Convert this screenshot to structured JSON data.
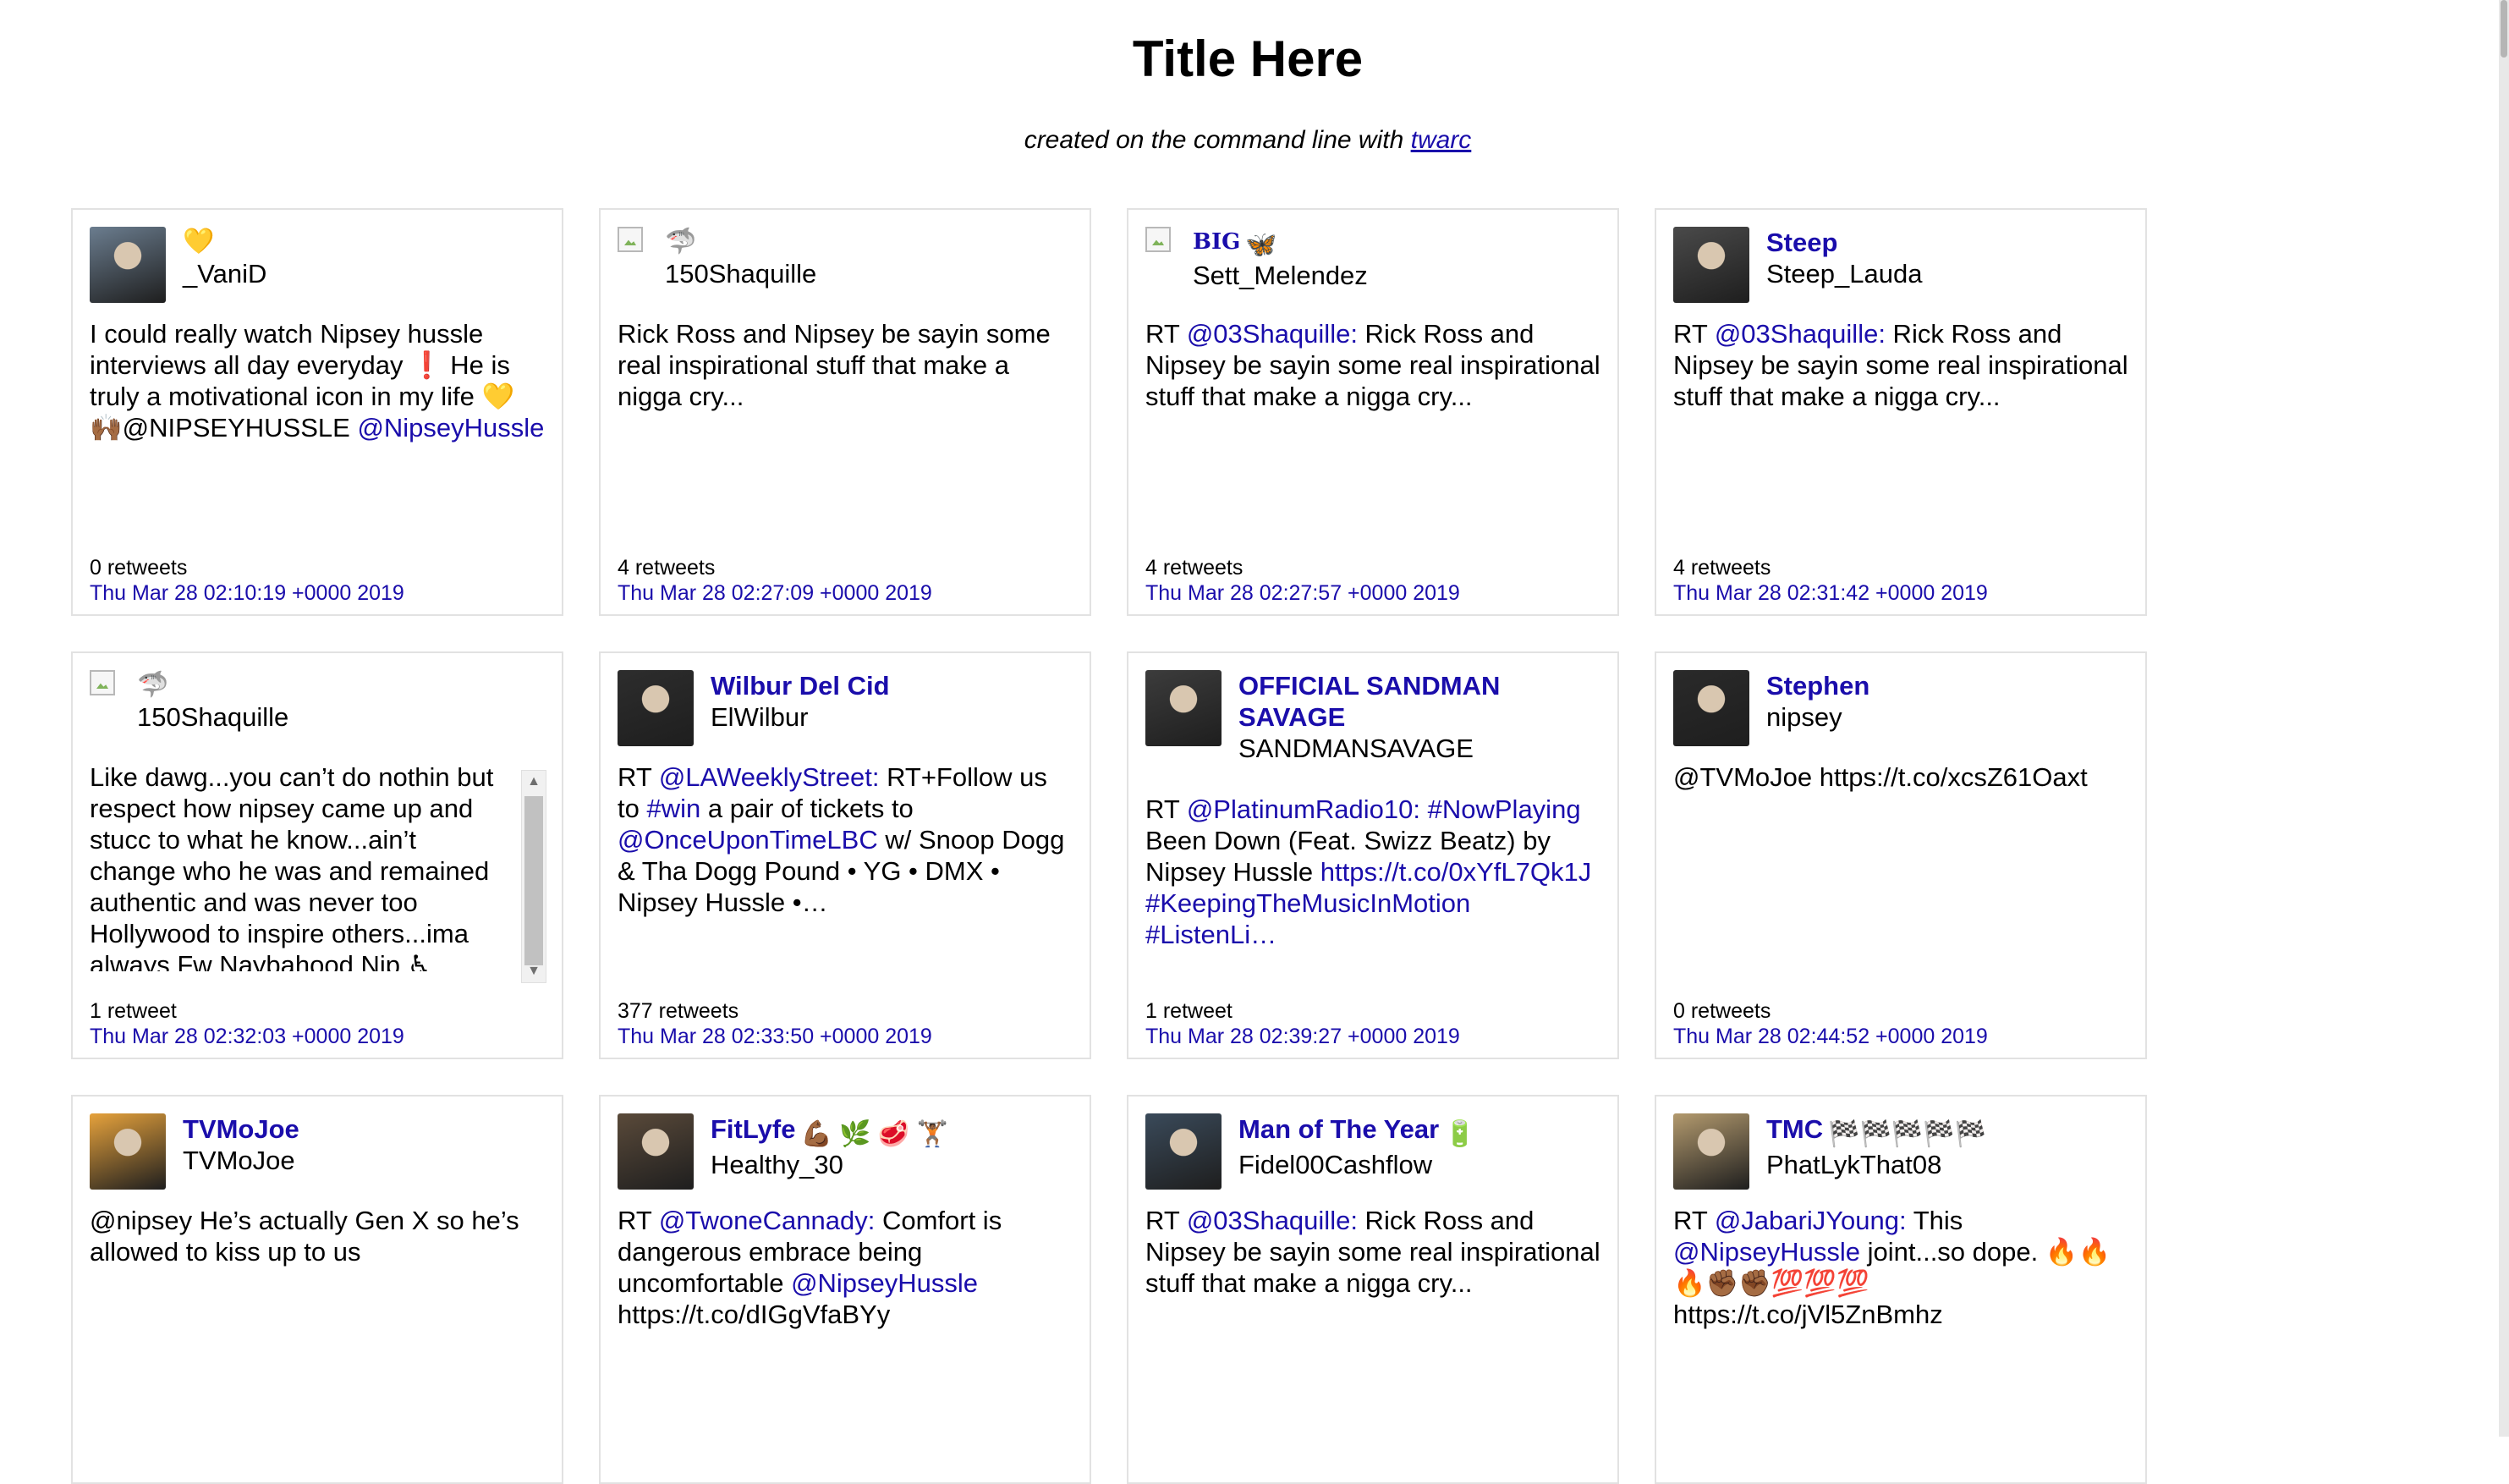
{
  "page": {
    "title": "Title Here",
    "subtitle_prefix": "created on the command line with ",
    "subtitle_link": "twarc"
  },
  "colors": {
    "link": "#1a0dab",
    "border": "#e2e2e2"
  },
  "cards": [
    {
      "display_name": "",
      "badge": "💛",
      "screen_name": "_VaniD",
      "avatar": "photo",
      "text_parts": [
        {
          "t": "I could really watch Nipsey hussle interviews all day everyday ❗ He is truly a motivational icon in my life 💛 🙌🏾@NIPSEYHUSSLE "
        },
        {
          "t": "@NipseyHussle",
          "link": true
        }
      ],
      "retweets": "0 retweets",
      "date": "Thu Mar 28 02:10:19 +0000 2019"
    },
    {
      "display_name": "",
      "badge": "🦈",
      "screen_name": "150Shaquille",
      "avatar": "broken",
      "text_parts": [
        {
          "t": "Rick Ross and Nipsey be sayin some real inspirational stuff that make a nigga cry..."
        }
      ],
      "retweets": "4 retweets",
      "date": "Thu Mar 28 02:27:09 +0000 2019"
    },
    {
      "display_name": "BIG",
      "badge": "🦋",
      "screen_name": "Sett_Melendez",
      "avatar": "broken",
      "text_parts": [
        {
          "t": "RT "
        },
        {
          "t": "@03Shaquille:",
          "link": true
        },
        {
          "t": " Rick Ross and Nipsey be sayin some real inspirational stuff that make a nigga cry..."
        }
      ],
      "retweets": "4 retweets",
      "date": "Thu Mar 28 02:27:57 +0000 2019"
    },
    {
      "display_name": "Steep",
      "badge": "",
      "screen_name": "Steep_Lauda",
      "avatar": "photo",
      "text_parts": [
        {
          "t": "RT "
        },
        {
          "t": "@03Shaquille:",
          "link": true
        },
        {
          "t": " Rick Ross and Nipsey be sayin some real inspirational stuff that make a nigga cry..."
        }
      ],
      "retweets": "4 retweets",
      "date": "Thu Mar 28 02:31:42 +0000 2019"
    },
    {
      "display_name": "",
      "badge": "🦈",
      "screen_name": "150Shaquille",
      "avatar": "broken",
      "text_parts": [
        {
          "t": "Like dawg...you can’t do nothin but respect how nipsey came up and stucc to what he know...ain’t change who he was and remained authentic and was never too Hollywood to inspire others...ima always Fw Naybahood Nip ♿"
        }
      ],
      "retweets": "1 retweet",
      "date": "Thu Mar 28 02:32:03 +0000 2019"
    },
    {
      "display_name": "Wilbur Del Cid",
      "badge": "",
      "screen_name": "ElWilbur",
      "avatar": "photo",
      "text_parts": [
        {
          "t": "RT "
        },
        {
          "t": "@LAWeeklyStreet:",
          "link": true
        },
        {
          "t": " RT+Follow us to "
        },
        {
          "t": "#win",
          "link": true
        },
        {
          "t": " a pair of tickets to "
        },
        {
          "t": "@OnceUponTimeLBC",
          "link": true
        },
        {
          "t": " w/ Snoop Dogg & Tha Dogg Pound • YG • DMX • Nipsey Hussle •…"
        }
      ],
      "retweets": "377 retweets",
      "date": "Thu Mar 28 02:33:50 +0000 2019"
    },
    {
      "display_name": "OFFICIAL SANDMAN SAVAGE",
      "badge": "",
      "screen_name": "SANDMANSAVAGE",
      "avatar": "photo",
      "text_parts": [
        {
          "t": "RT "
        },
        {
          "t": "@PlatinumRadio10:",
          "link": true
        },
        {
          "t": " "
        },
        {
          "t": "#NowPlaying",
          "link": true
        },
        {
          "t": " Been Down (Feat. Swizz Beatz) by Nipsey Hussle "
        },
        {
          "t": "https://t.co/0xYfL7Qk1J",
          "link": true
        },
        {
          "t": " "
        },
        {
          "t": "#KeepingTheMusicInMotion",
          "link": true
        },
        {
          "t": " "
        },
        {
          "t": "#ListenLi…",
          "link": true
        }
      ],
      "retweets": "1 retweet",
      "date": "Thu Mar 28 02:39:27 +0000 2019"
    },
    {
      "display_name": "Stephen",
      "badge": "",
      "screen_name": "nipsey",
      "avatar": "photo",
      "text_parts": [
        {
          "t": "@TVMoJoe https://t.co/xcsZ61Oaxt"
        }
      ],
      "retweets": "0 retweets",
      "date": "Thu Mar 28 02:44:52 +0000 2019"
    },
    {
      "display_name": "TVMoJoe",
      "badge": "",
      "screen_name": "TVMoJoe",
      "avatar": "photo",
      "text_parts": [
        {
          "t": "@nipsey He’s actually Gen X so he’s allowed to kiss up to us"
        }
      ],
      "retweets": "",
      "date": ""
    },
    {
      "display_name": "FitLyfe",
      "badge": "💪🏾 🌿 🥩 🏋🏾",
      "screen_name": "Healthy_30",
      "avatar": "photo",
      "text_parts": [
        {
          "t": "RT "
        },
        {
          "t": "@TwoneCannady:",
          "link": true
        },
        {
          "t": " Comfort is dangerous embrace being uncomfortable "
        },
        {
          "t": "@NipseyHussle",
          "link": true
        },
        {
          "t": " https://t.co/dIGgVfaBYy"
        }
      ],
      "retweets": "",
      "date": ""
    },
    {
      "display_name": "Man of The Year",
      "badge": "🔋",
      "screen_name": "Fidel00Cashflow",
      "avatar": "photo",
      "text_parts": [
        {
          "t": "RT "
        },
        {
          "t": "@03Shaquille:",
          "link": true
        },
        {
          "t": " Rick Ross and Nipsey be sayin some real inspirational stuff that make a nigga cry..."
        }
      ],
      "retweets": "",
      "date": ""
    },
    {
      "display_name": "TMC",
      "badge": "🏁🏁🏁🏁🏁",
      "screen_name": "PhatLykThat08",
      "avatar": "photo",
      "text_parts": [
        {
          "t": "RT "
        },
        {
          "t": "@JabariJYoung:",
          "link": true
        },
        {
          "t": " This "
        },
        {
          "t": "@NipseyHussle",
          "link": true
        },
        {
          "t": " joint...so dope. 🔥🔥 🔥✊🏾✊🏾💯💯💯 https://t.co/jVl5ZnBmhz"
        }
      ],
      "retweets": "",
      "date": ""
    }
  ]
}
